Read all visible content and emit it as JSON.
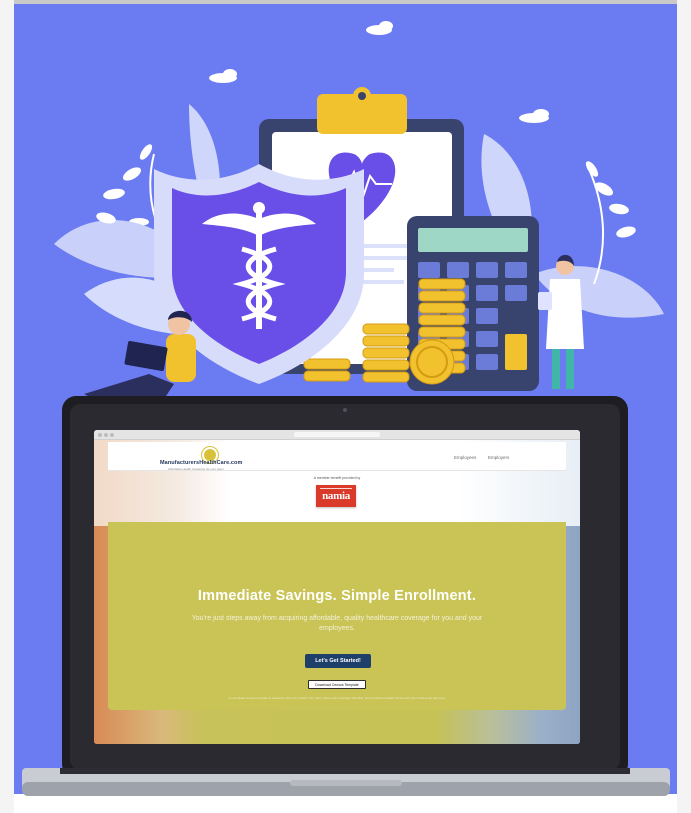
{
  "site": {
    "brand": "ManufacturersHealthCare.com",
    "tagline": "Affordable Health Insurance for your team",
    "nav": [
      "Employees",
      "Employers"
    ],
    "provided_by": "A member benefit provided by",
    "partner_logo": "namia"
  },
  "hero": {
    "headline": "Immediate Savings. Simple Enrollment.",
    "subtext": "You're just steps away from acquiring affordable, quality healthcare coverage for you and your employees.",
    "cta_primary": "Let's Get Started!",
    "cta_secondary": "Download Census Template",
    "fine_print": "A completed census template is needed in order for review. Your rates, plans and coverages will differ, and enrollment details will be sent upon final quote approval."
  },
  "illustration": {
    "background_color": "#6b7bf2",
    "icons": [
      "shield-caduceus-icon",
      "clipboard-heart-icon",
      "calculator-icon",
      "coin-stack-icon",
      "person-with-laptop",
      "doctor-figure",
      "leaf-decoration",
      "cloud-decoration"
    ]
  },
  "colors": {
    "accent_navy": "#1f3f6b",
    "hero_olive": "#c9c455",
    "gold": "#f2c12e",
    "shield_purple": "#6a4ee8"
  }
}
